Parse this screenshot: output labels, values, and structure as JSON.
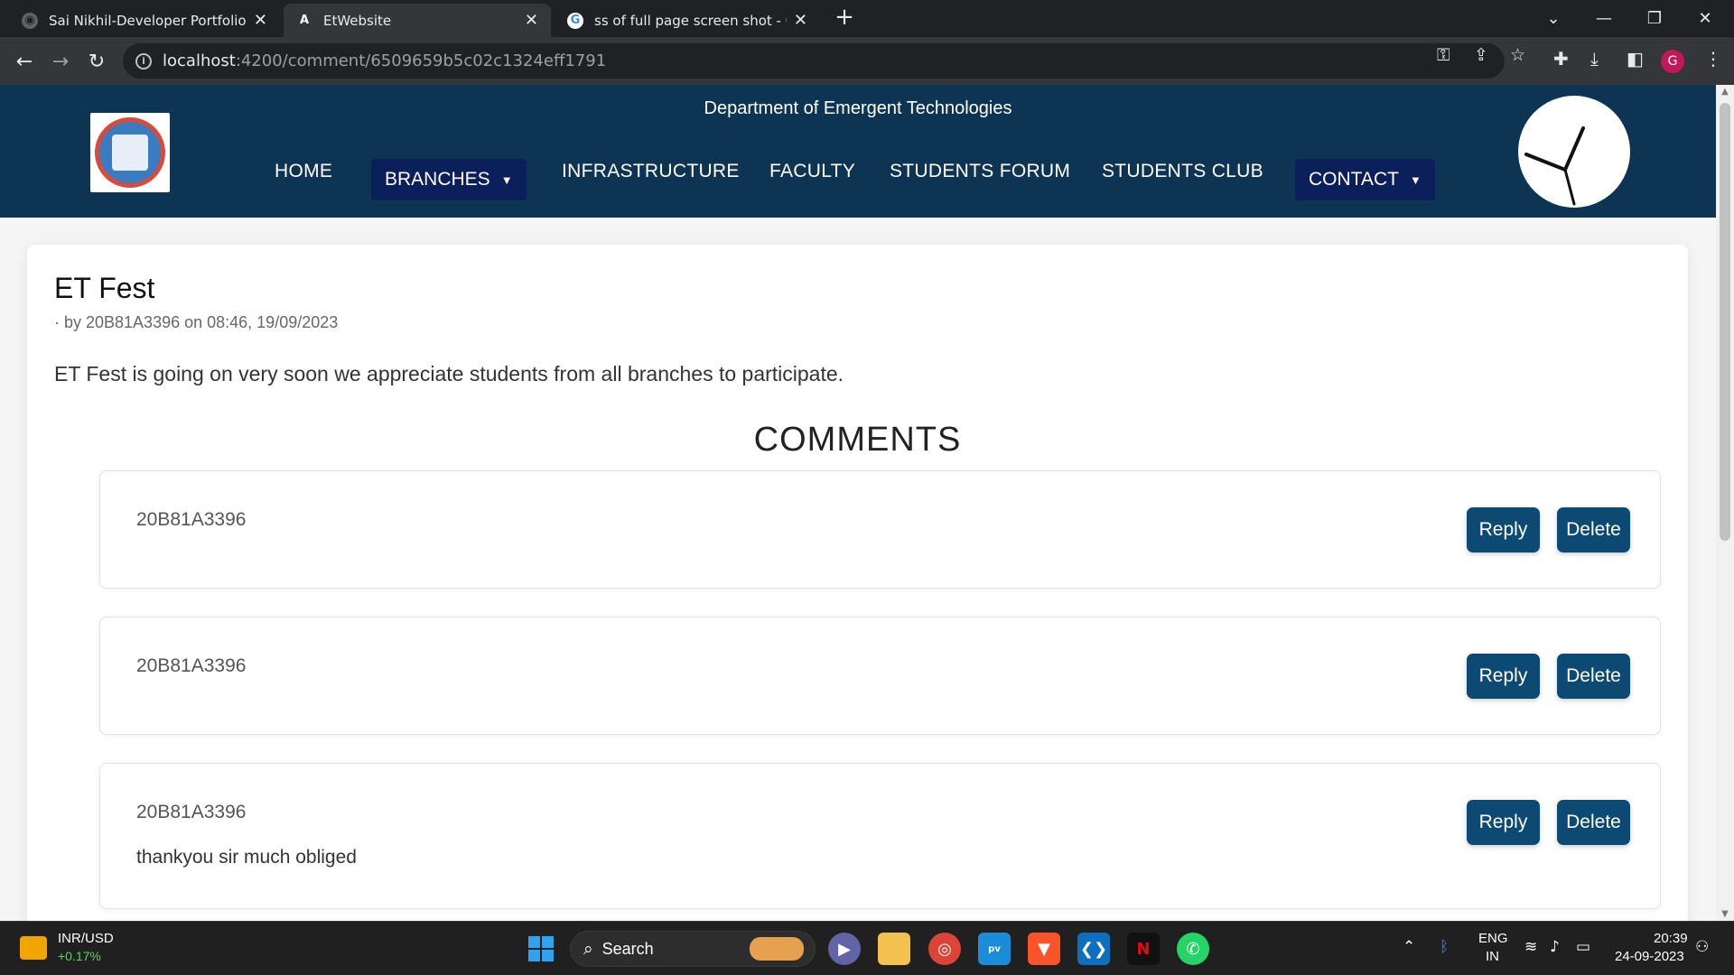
{
  "browser": {
    "tabs": [
      {
        "title": "Sai Nikhil-Developer Portfolio",
        "active": false
      },
      {
        "title": "EtWebsite",
        "active": true
      },
      {
        "title": "ss of full page screen shot - Goo",
        "active": false
      }
    ],
    "url_host": "localhost",
    "url_path": ":4200/comment/6509659b5c02c1324eff1791",
    "profile_initial": "G"
  },
  "site": {
    "department": "Department of Emergent Technologies",
    "nav": {
      "home": "HOME",
      "branches": "BRANCHES",
      "infrastructure": "INFRASTRUCTURE",
      "faculty": "FACULTY",
      "students_forum": "STUDENTS FORUM",
      "students_club": "STUDENTS CLUB",
      "contact": "CONTACT"
    },
    "colors": {
      "header": "#0d3553",
      "dropdown": "#0b1f5a",
      "button": "#0d4a73"
    }
  },
  "post": {
    "title": "ET Fest",
    "meta": "· by 20B81A3396 on 08:46, 19/09/2023",
    "body": "ET Fest is going on very soon we appreciate students from all branches to participate."
  },
  "comments_heading": "COMMENTS",
  "comments": [
    {
      "author": "20B81A3396",
      "text": "",
      "reply": "Reply",
      "delete": "Delete"
    },
    {
      "author": "20B81A3396",
      "text": "",
      "reply": "Reply",
      "delete": "Delete"
    },
    {
      "author": "20B81A3396",
      "text": "thankyou sir much obliged",
      "reply": "Reply",
      "delete": "Delete"
    }
  ],
  "taskbar": {
    "widget_title": "INR/USD",
    "widget_value": "+0.17%",
    "search": "Search",
    "lang_top": "ENG",
    "lang_bottom": "IN",
    "time": "20:39",
    "date": "24-09-2023"
  }
}
